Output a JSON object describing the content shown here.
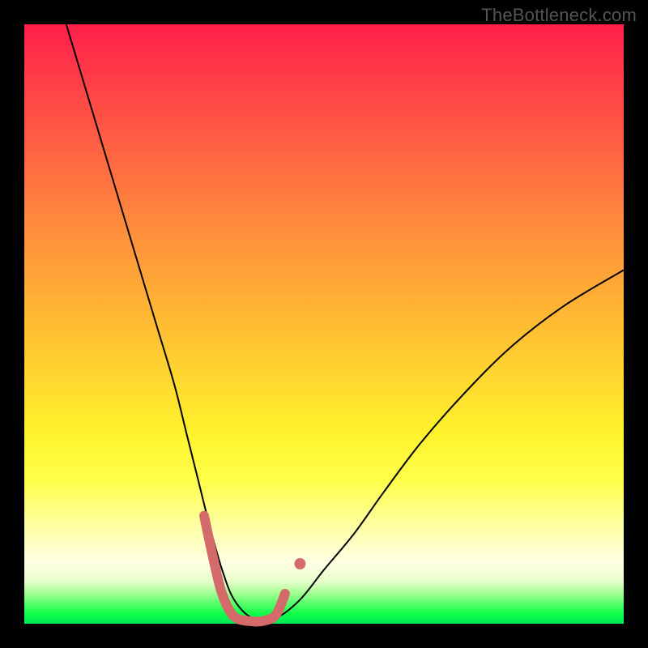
{
  "watermark": "TheBottleneck.com",
  "chart_data": {
    "type": "line",
    "title": "",
    "xlabel": "",
    "ylabel": "",
    "xlim": [
      0,
      100
    ],
    "ylim": [
      0,
      100
    ],
    "grid": false,
    "legend": false,
    "gradient_stops": [
      {
        "pos": 0,
        "color": "#ff1f4a"
      },
      {
        "pos": 8,
        "color": "#ff3a48"
      },
      {
        "pos": 20,
        "color": "#ff6043"
      },
      {
        "pos": 33,
        "color": "#ff8a3d"
      },
      {
        "pos": 46,
        "color": "#ffb035"
      },
      {
        "pos": 58,
        "color": "#ffd430"
      },
      {
        "pos": 68,
        "color": "#fff22c"
      },
      {
        "pos": 76,
        "color": "#ffff4a"
      },
      {
        "pos": 84,
        "color": "#ffffa7"
      },
      {
        "pos": 90,
        "color": "#ffffe6"
      },
      {
        "pos": 93,
        "color": "#e6ffc9"
      },
      {
        "pos": 95,
        "color": "#9fff8f"
      },
      {
        "pos": 97,
        "color": "#47ff63"
      },
      {
        "pos": 98.5,
        "color": "#0bff46"
      },
      {
        "pos": 100,
        "color": "#00e85a"
      }
    ],
    "series": [
      {
        "name": "bottleneck-curve",
        "color": "#000000",
        "stroke_width": 2,
        "x": [
          7,
          10,
          13,
          16,
          19,
          22,
          25,
          27,
          29,
          31,
          33,
          35,
          38,
          42,
          46,
          50,
          55,
          60,
          66,
          73,
          81,
          90,
          100
        ],
        "y": [
          100,
          90,
          80,
          70,
          60,
          50,
          40,
          32,
          24,
          16,
          9,
          4,
          1,
          1,
          4,
          9,
          15,
          22,
          30,
          38,
          46,
          53,
          59
        ]
      },
      {
        "name": "highlight-segment",
        "color": "#d56a6a",
        "stroke_width": 12,
        "linecap": "round",
        "x": [
          30,
          31.5,
          33,
          35,
          38,
          40,
          42,
          43.5
        ],
        "y": [
          18,
          11,
          5,
          1.2,
          0.4,
          0.5,
          1.5,
          5
        ]
      }
    ],
    "markers": [
      {
        "name": "highlight-dot",
        "x": 46,
        "y": 10,
        "r": 7,
        "color": "#d56a6a"
      }
    ]
  }
}
